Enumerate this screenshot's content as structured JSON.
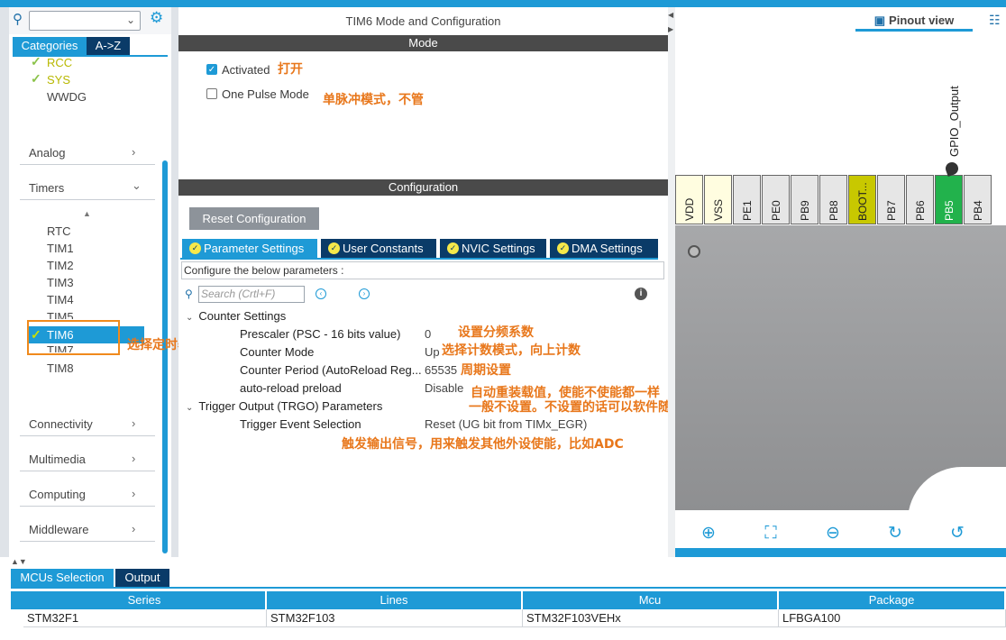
{
  "left": {
    "categories_tab": "Categories",
    "az_tab": "A->Z",
    "system_items": [
      {
        "label": "RCC",
        "checked": true
      },
      {
        "label": "SYS",
        "checked": true
      },
      {
        "label": "WWDG",
        "checked": false
      }
    ],
    "groups": {
      "analog": "Analog",
      "timers": "Timers",
      "connectivity": "Connectivity",
      "multimedia": "Multimedia",
      "computing": "Computing",
      "middleware": "Middleware"
    },
    "timers": [
      "RTC",
      "TIM1",
      "TIM2",
      "TIM3",
      "TIM4",
      "TIM5",
      "TIM6",
      "TIM7",
      "TIM8"
    ],
    "note_select_timer": "选择定时器"
  },
  "center": {
    "title": "TIM6 Mode and Configuration",
    "mode_header": "Mode",
    "activated": "Activated",
    "one_pulse": "One Pulse Mode",
    "note_activated": "打开",
    "note_one_pulse": "单脉冲模式，不管",
    "config_header": "Configuration",
    "reset_btn": "Reset Configuration",
    "tabs": [
      "Parameter Settings",
      "User Constants",
      "NVIC Settings",
      "DMA Settings"
    ],
    "configure_text": "Configure the below parameters :",
    "search_placeholder": "Search (Crtl+F)",
    "counter_section": "Counter Settings",
    "params": [
      {
        "name": "Prescaler (PSC - 16 bits value)",
        "value": "0",
        "note": "设置分频系数"
      },
      {
        "name": "Counter Mode",
        "value": "Up",
        "note": "选择计数模式，向上计数"
      },
      {
        "name": "Counter Period (AutoReload Reg...",
        "value": "65535",
        "note": "周期设置"
      },
      {
        "name": "auto-reload preload",
        "value": "Disable",
        "note": "自动重装载值，使能不使能都一样"
      }
    ],
    "note_preload2": "一般不设置。不设置的话可以软件随时更新",
    "trigger_section": "Trigger Output (TRGO) Parameters",
    "trigger_param": "Trigger Event Selection",
    "trigger_value": "Reset (UG bit from TIMx_EGR)",
    "note_trigger": "触发输出信号，用来触发其他外设使能，比如ADC"
  },
  "right": {
    "pinout_view": "Pinout view",
    "pins": [
      "VDD",
      "VSS",
      "PE1",
      "PE0",
      "PB9",
      "PB8",
      "BOOT...",
      "PB7",
      "PB6",
      "PB5",
      "PB4"
    ],
    "gpio_label": "GPIO_Output"
  },
  "bottom": {
    "tab_mcus": "MCUs Selection",
    "tab_output": "Output",
    "headers": [
      "Series",
      "Lines",
      "Mcu",
      "Package"
    ],
    "row": [
      "STM32F1",
      "STM32F103",
      "STM32F103VEHx",
      "LFBGA100"
    ]
  },
  "colors": {
    "accent": "#1e9ad6",
    "dark_tab": "#0a3b68",
    "note": "#e8771b",
    "active_pin": "#22b24c"
  }
}
